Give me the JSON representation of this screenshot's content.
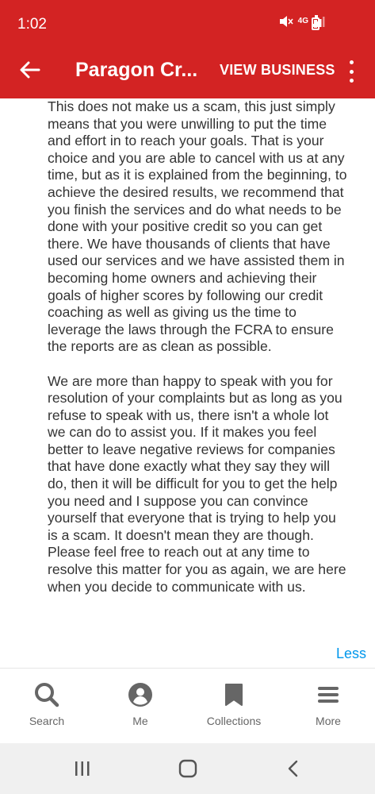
{
  "status_bar": {
    "time": "1:02",
    "network": "4G"
  },
  "app_bar": {
    "title": "Paragon Cr...",
    "view_business_label": "VIEW BUSINESS",
    "back_icon": "arrow-back-icon",
    "overflow_icon": "more-vert-icon"
  },
  "review_response": {
    "paragraph_1": "This does not make us a scam, this just simply means that you were unwilling to put the time and effort in to reach your goals.  That is your choice and you are able to cancel with us at any time, but as it is explained from the beginning, to achieve the desired results, we recommend that you finish the services and do what needs to be done with your positive credit so you can get there.  We have thousands of clients that have used our services and we have assisted them in becoming home owners and achieving their goals of higher scores by following our credit coaching as well as giving us the time to leverage the laws through the FCRA to ensure the reports are as clean as possible.",
    "paragraph_2": "We are more than happy to speak with you for resolution of your complaints but as long as you refuse to speak with us, there isn't a whole lot we can do to assist you.   If it makes you feel better to leave negative reviews for companies that have done exactly what they say they will do, then it will be difficult for you to get the help you need and I suppose you can convince yourself that everyone that is trying to help you is a scam.  It doesn't mean they are though.  Please feel free to reach out at any time to resolve this matter for you as again, we are here when you decide to communicate with us.",
    "less_label": "Less"
  },
  "bottom_nav": {
    "items": [
      {
        "label": "Search",
        "icon": "search-icon"
      },
      {
        "label": "Me",
        "icon": "profile-icon"
      },
      {
        "label": "Collections",
        "icon": "bookmark-icon"
      },
      {
        "label": "More",
        "icon": "menu-icon"
      }
    ]
  },
  "colors": {
    "brand_red": "#d32323",
    "link_blue": "#0097ec",
    "text": "#333333",
    "nav_icon": "#666666"
  }
}
